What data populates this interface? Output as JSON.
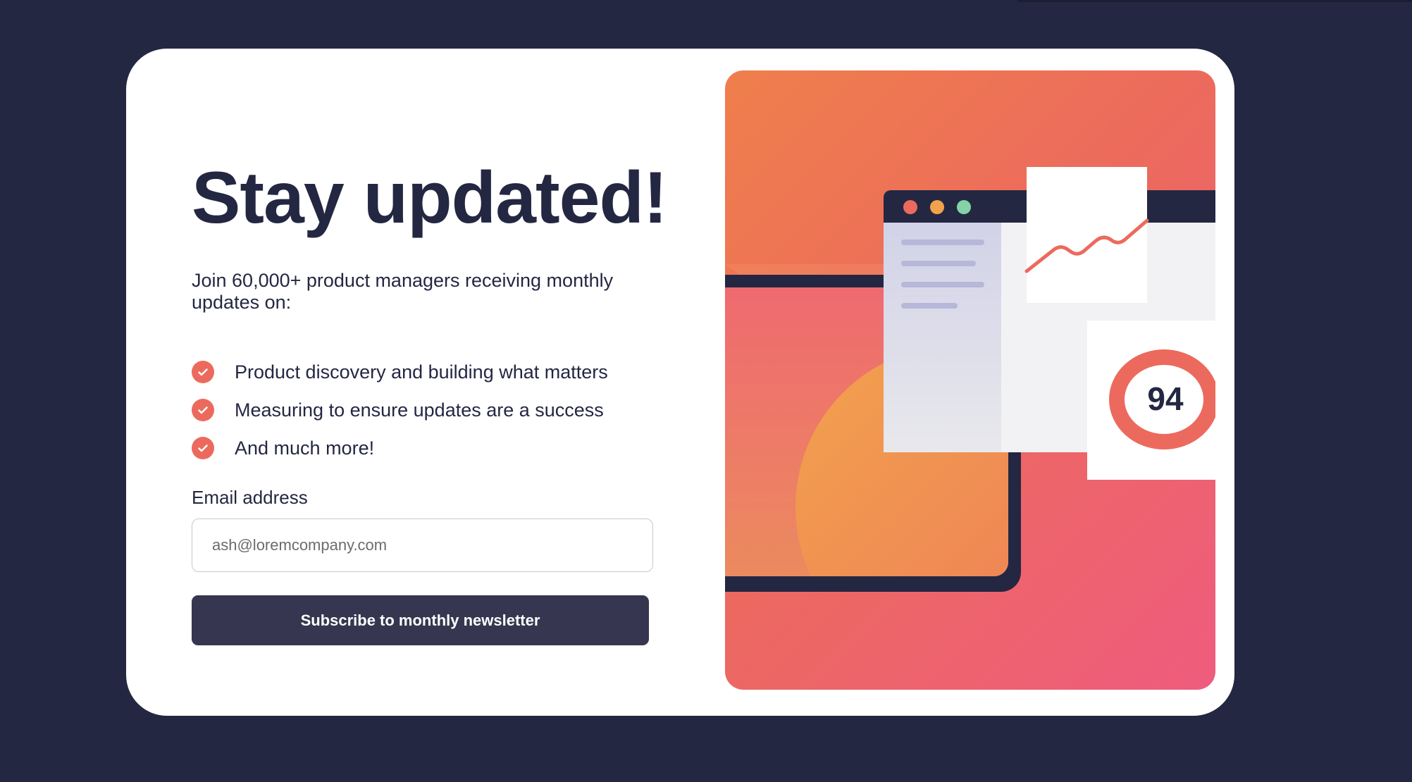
{
  "signup": {
    "title": "Stay updated!",
    "intro": "Join 60,000+ product managers receiving monthly updates on:",
    "features": [
      "Product discovery and building what matters",
      "Measuring to ensure updates are a success",
      "And much more!"
    ],
    "email_label": "Email address",
    "email_placeholder": "ash@loremcompany.com",
    "email_value": "",
    "subscribe_label": "Subscribe to monthly newsletter"
  },
  "illustration": {
    "score": "94",
    "window_dots": [
      "red-dot",
      "orange-dot",
      "green-dot"
    ]
  },
  "colors": {
    "background": "#242742",
    "accent": "#ec6a5d",
    "button": "#363650",
    "text": "#242742"
  },
  "icons": {
    "feature_bullet": "check-icon"
  }
}
